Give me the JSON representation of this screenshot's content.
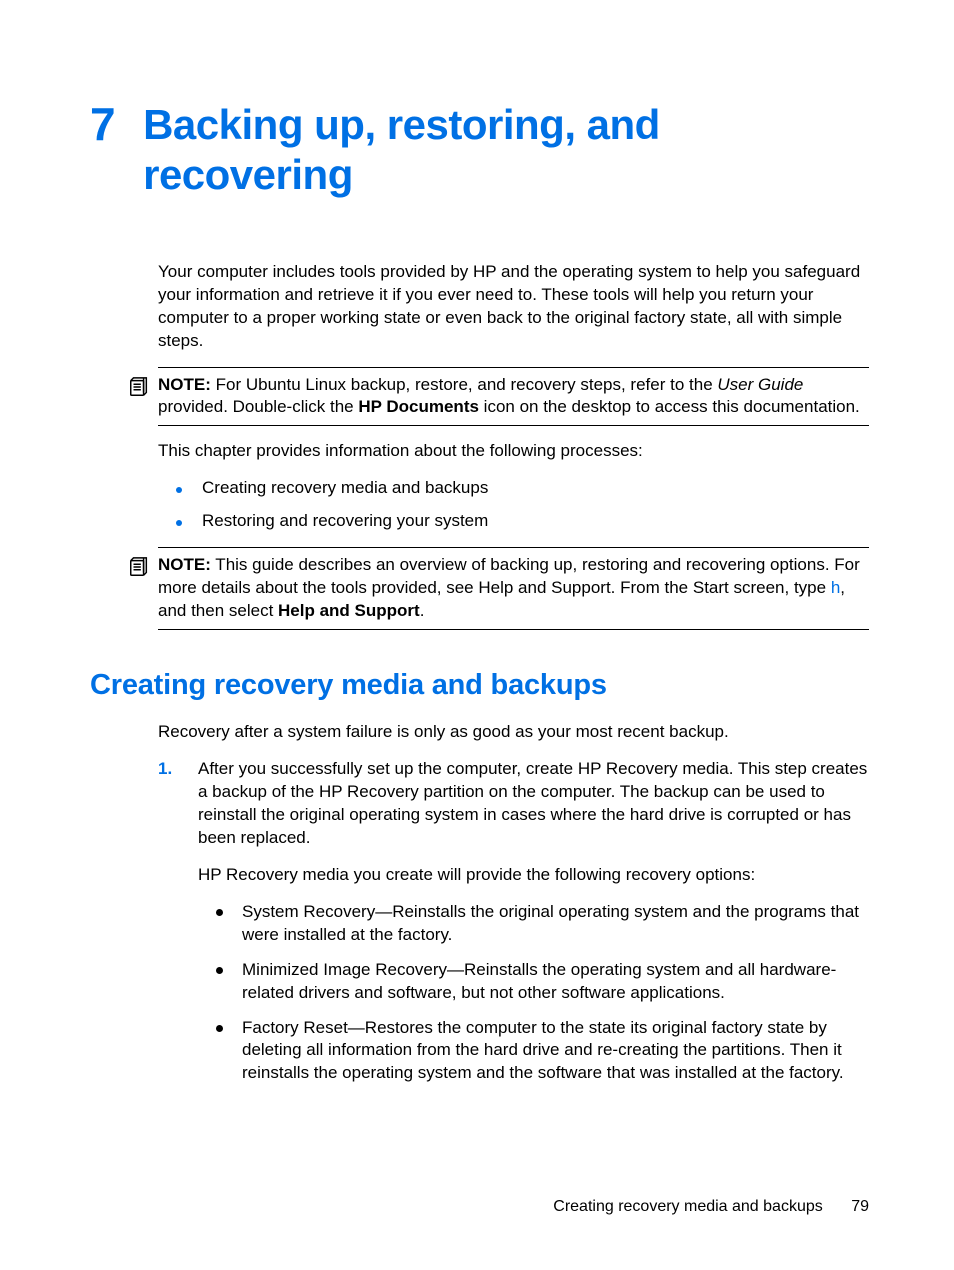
{
  "chapter": {
    "number": "7",
    "title": "Backing up, restoring, and recovering"
  },
  "intro_para": "Your computer includes tools provided by HP and the operating system to help you safeguard your information and retrieve it if you ever need to. These tools will help you return your computer to a proper working state or even back to the original factory state, all with simple steps.",
  "note1": {
    "label": "NOTE:",
    "pre": "   For Ubuntu Linux backup, restore, and recovery steps, refer to the ",
    "italic": "User Guide",
    "mid": " provided. Double-click the ",
    "bold": "HP Documents",
    "post": " icon on the desktop to access this documentation."
  },
  "processes_lead": "This chapter provides information about the following processes:",
  "processes": [
    "Creating recovery media and backups",
    "Restoring and recovering your system"
  ],
  "note2": {
    "label": "NOTE:",
    "pre": "   This guide describes an overview of backing up, restoring and recovering options. For more details about the tools provided, see Help and Support. From the Start screen, type ",
    "h": "h",
    "mid": ", and then select ",
    "bold": "Help and Support",
    "post": "."
  },
  "section_title": "Creating recovery media and backups",
  "section_intro": "Recovery after a system failure is only as good as your most recent backup.",
  "step1": {
    "para1": "After you successfully set up the computer, create HP Recovery media. This step creates a backup of the HP Recovery partition on the computer. The backup can be used to reinstall the original operating system in cases where the hard drive is corrupted or has been replaced.",
    "para2": "HP Recovery media you create will provide the following recovery options:",
    "bullets": [
      "System Recovery—Reinstalls the original operating system and the programs that were installed at the factory.",
      "Minimized Image Recovery—Reinstalls the operating system and all hardware-related drivers and software, but not other software applications.",
      "Factory Reset—Restores the computer to the state its original factory state by deleting all information from the hard drive and re-creating the partitions. Then it reinstalls the operating system and the software that was installed at the factory."
    ]
  },
  "footer": {
    "text": "Creating recovery media and backups",
    "page": "79"
  }
}
